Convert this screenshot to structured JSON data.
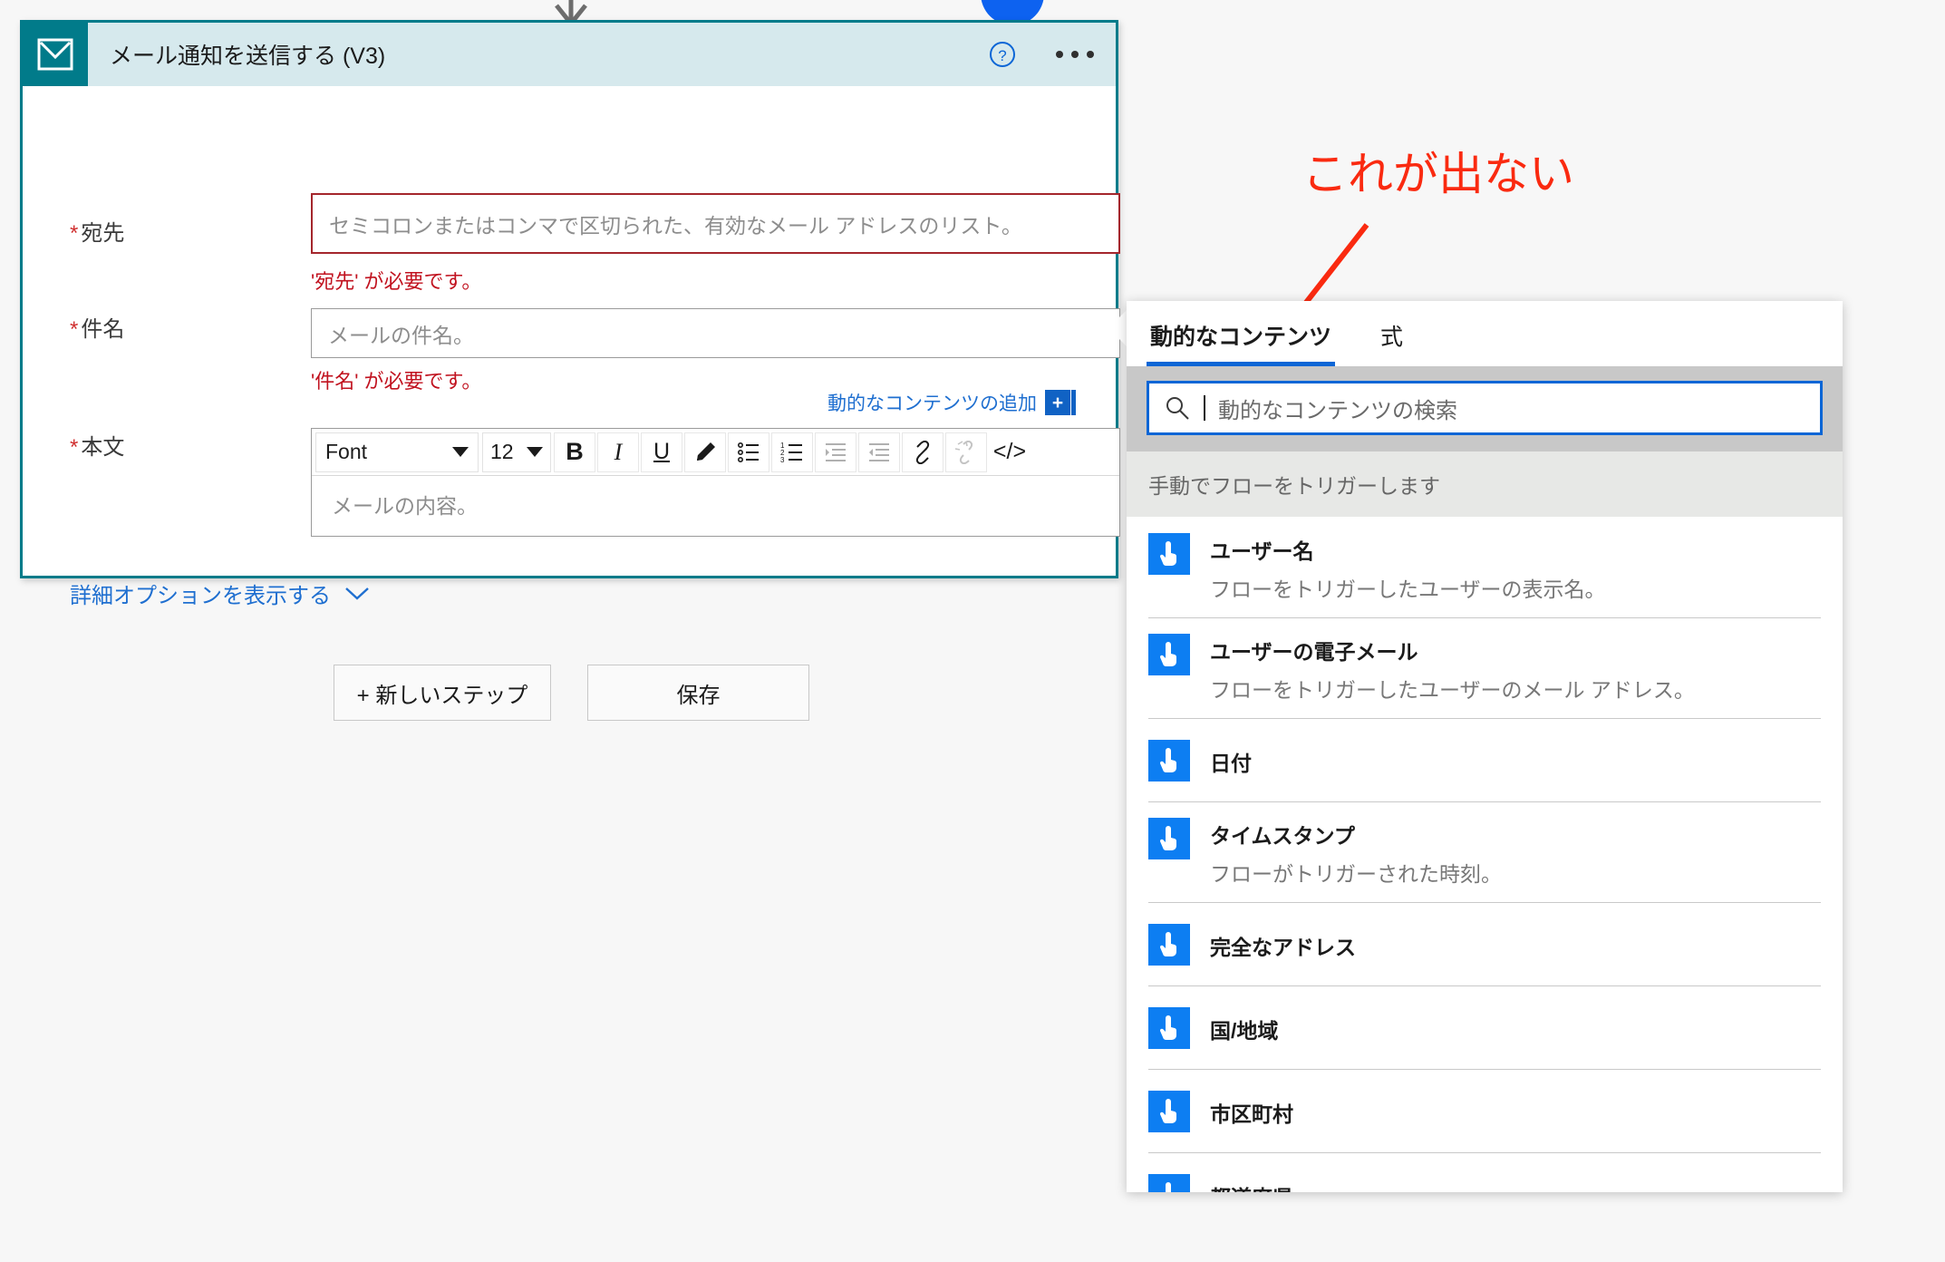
{
  "card": {
    "title": "メール通知を送信する (V3)",
    "icon": "mail-icon",
    "help_icon": "help-circle-icon",
    "more_icon": "ellipsis-icon",
    "fields": [
      {
        "label": "宛先",
        "required_mark": "*",
        "placeholder": "セミコロンまたはコンマで区切られた、有効なメール アドレスのリスト。",
        "value": "",
        "error": "'宛先' が必要です。",
        "state": "error"
      },
      {
        "label": "件名",
        "required_mark": "*",
        "placeholder": "メールの件名。",
        "value": "",
        "error": "'件名' が必要です。",
        "state": "normal"
      },
      {
        "label": "本文",
        "required_mark": "*",
        "placeholder": "メールの内容。",
        "value": "",
        "error": "",
        "state": "normal"
      }
    ],
    "dynamic_content_link": "動的なコンテンツの追加",
    "plus_label": "+",
    "advanced_options_link": "詳細オプションを表示する",
    "advanced_chevron": "chevron-down-icon",
    "accent_color": "#017b8a",
    "header_bg": "#d6e9ed",
    "error_color": "#c1121f",
    "link_color": "#1f6fd0"
  },
  "rte": {
    "font_name": "Font",
    "font_size": "12",
    "buttons": [
      {
        "name": "bold-button",
        "glyph": "B"
      },
      {
        "name": "italic-button",
        "glyph": "I"
      },
      {
        "name": "underline-button",
        "glyph": "U"
      },
      {
        "name": "highlighter-button",
        "glyph": "pen"
      },
      {
        "name": "bulleted-list-button",
        "glyph": "ul"
      },
      {
        "name": "numbered-list-button",
        "glyph": "ol"
      },
      {
        "name": "indent-button",
        "glyph": "indent"
      },
      {
        "name": "outdent-button",
        "glyph": "outdent"
      },
      {
        "name": "link-button",
        "glyph": "link"
      },
      {
        "name": "unlink-button",
        "glyph": "unlink"
      },
      {
        "name": "code-view-button",
        "glyph": "</>"
      }
    ]
  },
  "footer_buttons": [
    {
      "name": "new-step-button",
      "label": "+ 新しいステップ"
    },
    {
      "name": "save-button",
      "label": "保存"
    }
  ],
  "annotation": {
    "text": "これが出ない",
    "color": "#fa2a10",
    "arrow": "red-arrow-down-left"
  },
  "flyout": {
    "tabs": [
      {
        "label": "動的なコンテンツ",
        "active": true
      },
      {
        "label": "式",
        "active": false
      }
    ],
    "search": {
      "placeholder": "動的なコンテンツの検索",
      "value": "",
      "icon": "search-icon"
    },
    "group_title": "手動でフローをトリガーします",
    "items": [
      {
        "name": "ユーザー名",
        "desc": "フローをトリガーしたユーザーの表示名。",
        "icon": "touch-trigger-icon"
      },
      {
        "name": "ユーザーの電子メール",
        "desc": "フローをトリガーしたユーザーのメール アドレス。",
        "icon": "touch-trigger-icon"
      },
      {
        "name": "日付",
        "desc": "",
        "icon": "touch-trigger-icon"
      },
      {
        "name": "タイムスタンプ",
        "desc": "フローがトリガーされた時刻。",
        "icon": "touch-trigger-icon"
      },
      {
        "name": "完全なアドレス",
        "desc": "",
        "icon": "touch-trigger-icon"
      },
      {
        "name": "国/地域",
        "desc": "",
        "icon": "touch-trigger-icon"
      },
      {
        "name": "市区町村",
        "desc": "",
        "icon": "touch-trigger-icon"
      },
      {
        "name": "都道府県",
        "desc": "",
        "icon": "touch-trigger-icon"
      }
    ],
    "accent_color": "#0c66d6",
    "icon_color": "#0d7ef2"
  }
}
